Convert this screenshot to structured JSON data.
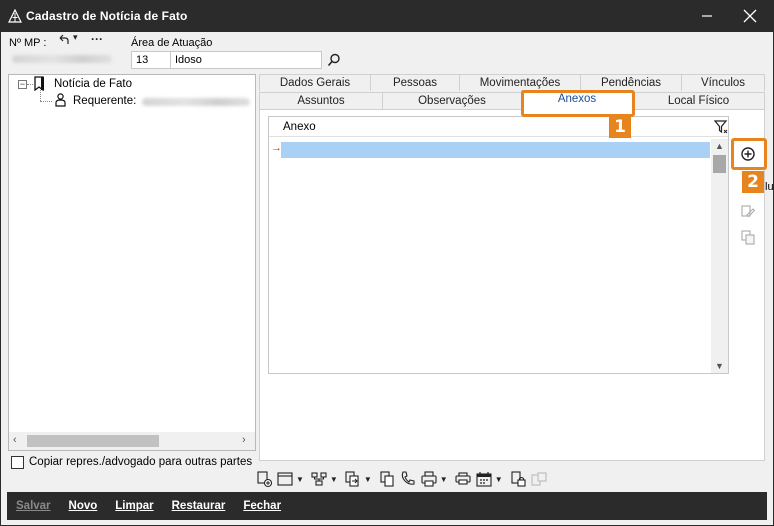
{
  "window": {
    "title": "Cadastro de Notícia de Fato"
  },
  "header": {
    "mp_label": "Nº MP :",
    "area_label": "Área de Atuação",
    "area_code": "13",
    "area_name": "Idoso"
  },
  "tree": {
    "root_label": "Notícia de Fato",
    "child_label": "Requerente:"
  },
  "copy_checkbox_label": "Copiar repres./advogado para outras partes",
  "tabs": {
    "row1": [
      "Dados Gerais",
      "Pessoas",
      "Movimentações",
      "Pendências",
      "Vínculos"
    ],
    "row2": [
      "Assuntos",
      "Observações",
      "Anexos",
      "Local Físico"
    ],
    "active": "Anexos"
  },
  "grid": {
    "column_header": "Anexo"
  },
  "side_tooltip_fragment": "lu",
  "callouts": {
    "one": "1",
    "two": "2"
  },
  "actions": {
    "salvar": "Salvar",
    "novo": "Novo",
    "limpar": "Limpar",
    "restaurar": "Restaurar",
    "fechar": "Fechar"
  },
  "colors": {
    "titlebar": "#2b2b2b",
    "accent_callout": "#e8841e",
    "selection": "#a9d1f5",
    "active_tab_text": "#1a4f9c"
  }
}
